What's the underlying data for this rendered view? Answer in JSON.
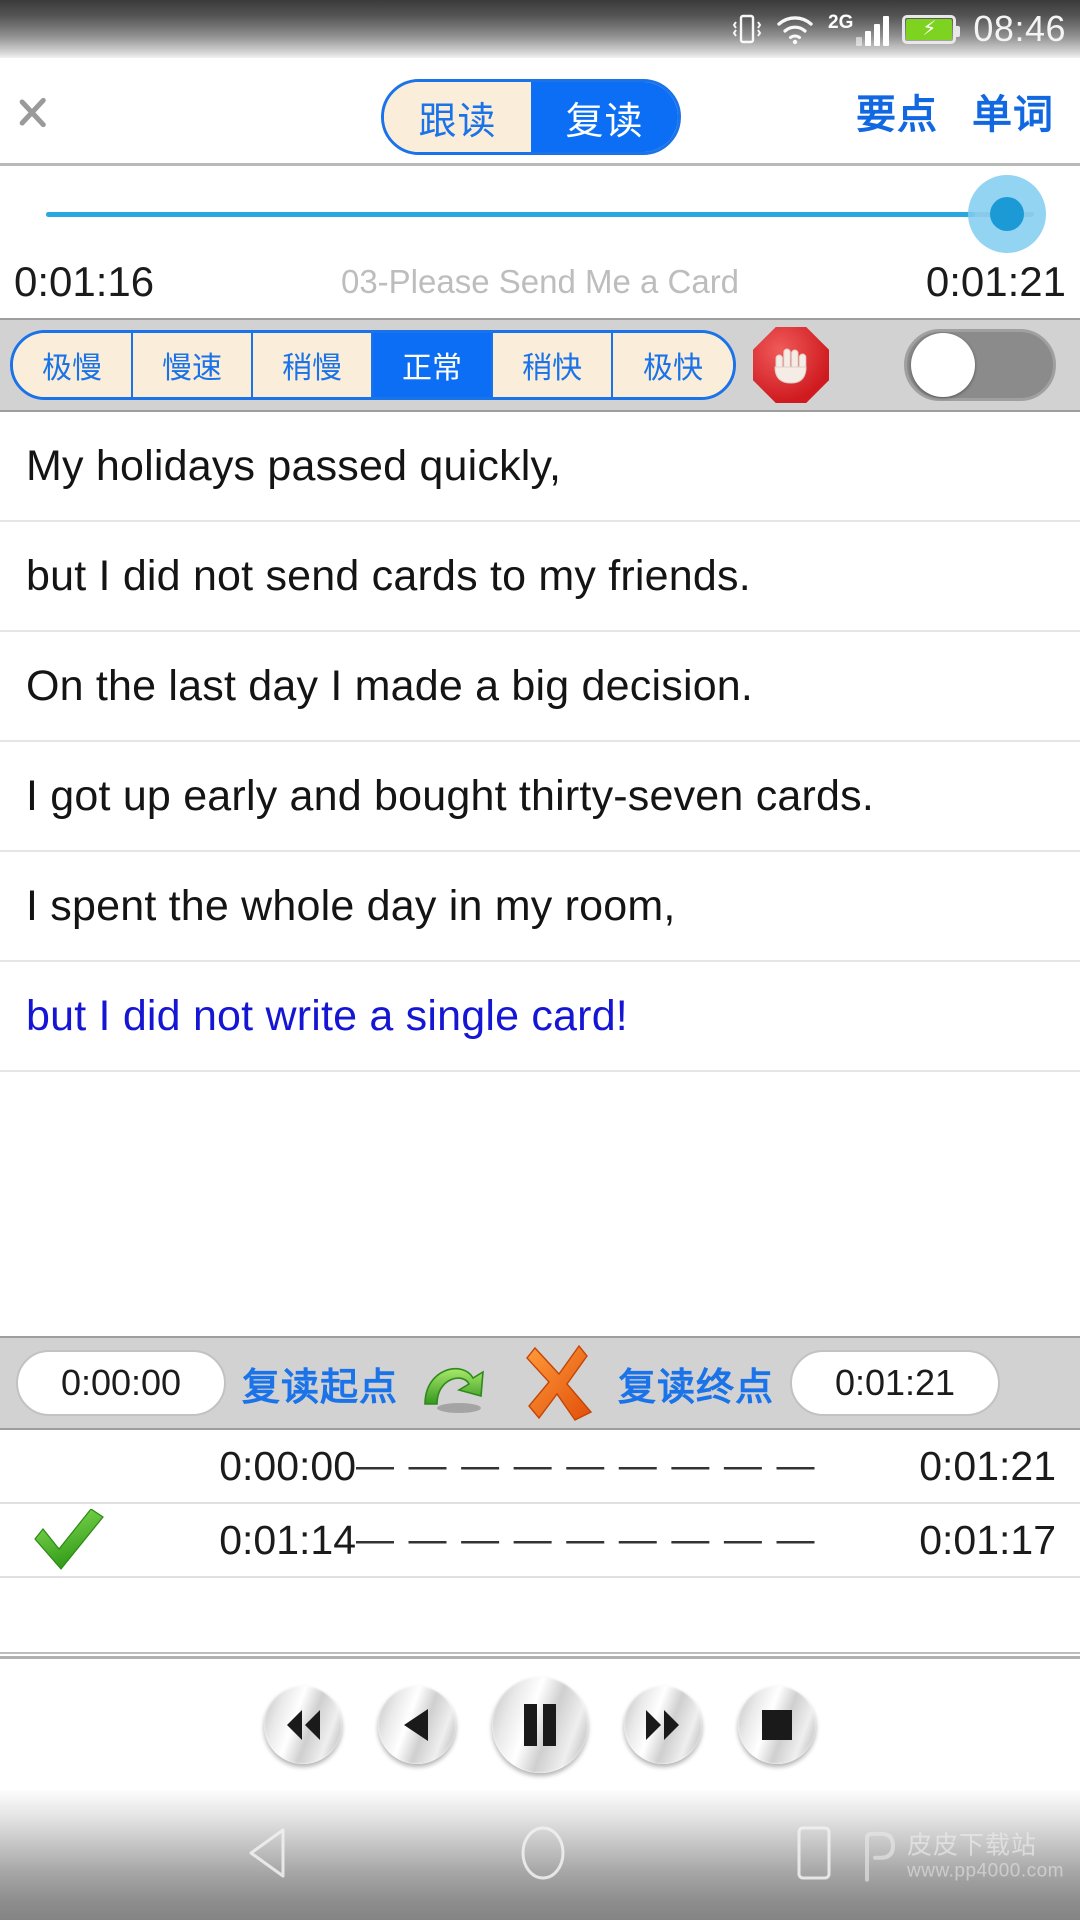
{
  "status_bar": {
    "time": "08:46",
    "network_label": "2G",
    "icons": [
      "vibrate-icon",
      "wifi-icon",
      "signal-icon",
      "battery-charging-icon"
    ]
  },
  "header": {
    "back_icon": "chevron-left-icon",
    "tabs": [
      {
        "label": "跟读",
        "active": false
      },
      {
        "label": "复读",
        "active": true
      }
    ],
    "links": [
      {
        "label": "要点"
      },
      {
        "label": "单词"
      }
    ]
  },
  "player_seek": {
    "current_time": "0:01:16",
    "total_time": "0:01:21",
    "track_title": "03-Please Send Me a Card",
    "progress_percent": 93
  },
  "speed_bar": {
    "speeds": [
      {
        "label": "极慢",
        "active": false
      },
      {
        "label": "慢速",
        "active": false
      },
      {
        "label": "稍慢",
        "active": false
      },
      {
        "label": "正常",
        "active": true
      },
      {
        "label": "稍快",
        "active": false
      },
      {
        "label": "极快",
        "active": false
      }
    ],
    "stop_icon": "stop-hand-icon",
    "toggle_on": false
  },
  "sentences": [
    {
      "text": "My holidays passed quickly,",
      "highlight": false
    },
    {
      "text": "but I did not send cards to my friends.",
      "highlight": false
    },
    {
      "text": "On the last day I made a big decision.",
      "highlight": false
    },
    {
      "text": "I got up early and bought thirty-seven cards.",
      "highlight": false
    },
    {
      "text": "I spent the whole day in my room,",
      "highlight": false
    },
    {
      "text": "but I did not write a single card!",
      "highlight": true
    }
  ],
  "repeat_bar": {
    "start_time": "0:00:00",
    "start_label": "复读起点",
    "loop_icon": "green-loop-arrow-icon",
    "cancel_icon": "orange-cross-icon",
    "end_label": "复读终点",
    "end_time": "0:01:21"
  },
  "mark_list": [
    {
      "checked": false,
      "start": "0:00:00",
      "dash": "— — — — — — — — — — — —",
      "end": "0:01:21"
    },
    {
      "checked": true,
      "start": "0:01:14",
      "dash": "— — — — — — — — — — — —",
      "end": "0:01:17"
    }
  ],
  "player_controls": [
    {
      "name": "rewind-button",
      "icon": "rewind-icon"
    },
    {
      "name": "previous-button",
      "icon": "play-back-icon"
    },
    {
      "name": "pause-button",
      "icon": "pause-icon"
    },
    {
      "name": "forward-button",
      "icon": "fast-forward-icon"
    },
    {
      "name": "stop-button",
      "icon": "stop-square-icon"
    }
  ],
  "nav_bar": {
    "back_icon": "triangle-back-icon",
    "home_icon": "circle-home-icon",
    "recents_icon": "square-recents-icon"
  },
  "watermark": {
    "site_name": "皮皮下载站",
    "url": "www.pp4000.com"
  },
  "colors": {
    "accent_blue": "#0b6ef5",
    "link_blue": "#1168e0",
    "cream": "#faedd9",
    "seek_blue": "#29a8e0",
    "highlight_text": "#1515d4",
    "bar_gray": "#d2d2d2",
    "green": "#5cc42c",
    "orange": "#f26a1b",
    "red": "#cf1b20"
  }
}
